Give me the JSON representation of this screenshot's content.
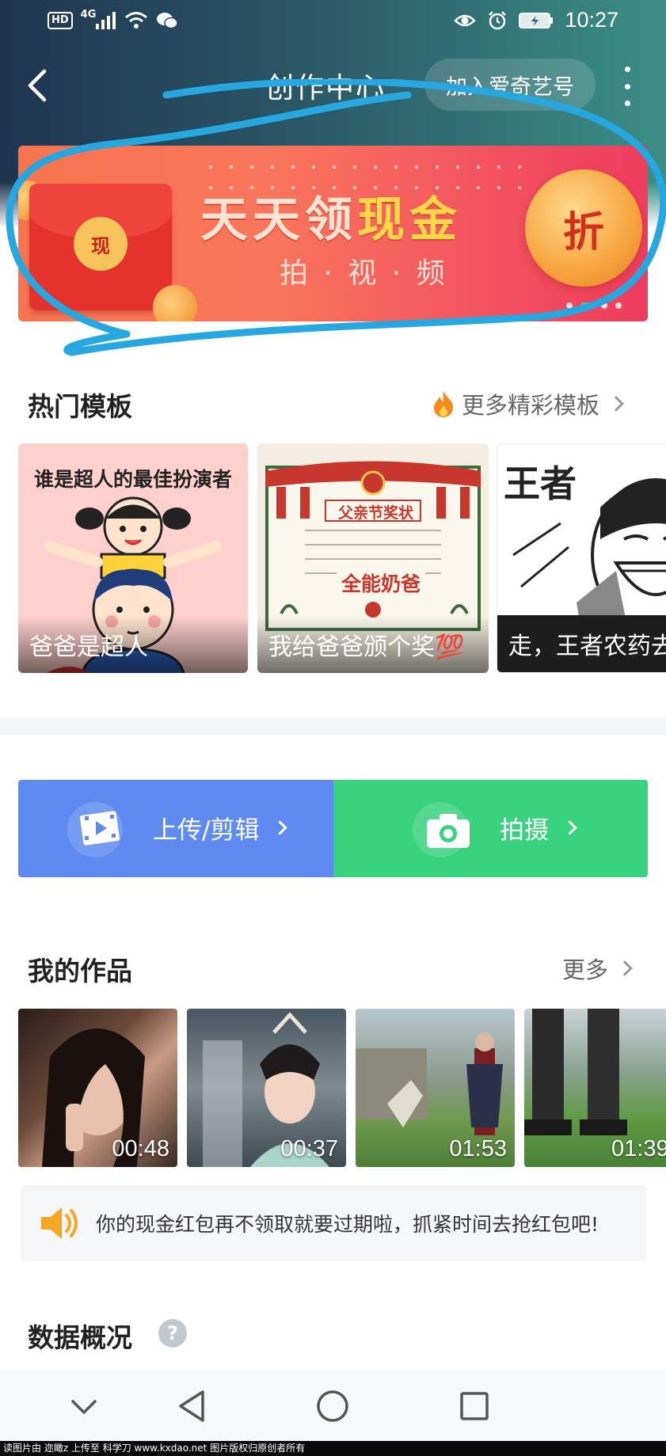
{
  "status_bar": {
    "hd": "HD",
    "network": "4G",
    "time": "10:27"
  },
  "nav": {
    "title": "创作中心",
    "join_button": "加入爱奇艺号"
  },
  "banner": {
    "envelope_char": "现",
    "title_part1": "天天领",
    "title_highlight": "现金",
    "subtitle": "拍 · 视 · 频",
    "coin_char": "折",
    "indicator_count": 4,
    "active_indicator": 1
  },
  "hot_templates": {
    "heading": "热门模板",
    "more_label": "更多精彩模板",
    "items": [
      {
        "label": "爸爸是超人",
        "caption": "谁是超人的最佳扮演者"
      },
      {
        "label": "我给爸爸颁个奖💯",
        "caption": "父亲节奖状",
        "award_name": "全能奶爸"
      },
      {
        "label": "走，王者农药去",
        "caption": "王者"
      }
    ]
  },
  "actions": {
    "upload_label": "上传/剪辑",
    "shoot_label": "拍摄"
  },
  "my_works": {
    "heading": "我的作品",
    "more_label": "更多",
    "items": [
      {
        "duration": "00:48"
      },
      {
        "duration": "00:37"
      },
      {
        "duration": "01:53"
      },
      {
        "duration": "01:39"
      }
    ]
  },
  "notice": {
    "text": "你的现金红包再不领取就要过期啦，抓紧时间去抢红包吧!"
  },
  "data_overview": {
    "heading": "数据概况",
    "help": "?"
  },
  "footer": {
    "text": "读图片由 迩瞰z 上传至 科学刀 www.kxdao.net 图片版权归原创者所有"
  },
  "colors": {
    "upload_bg": "#5f8af0",
    "shoot_bg": "#39d27f",
    "banner_start": "#f7744f",
    "banner_end": "#ee3c5e",
    "annotation": "#27a7e0"
  }
}
